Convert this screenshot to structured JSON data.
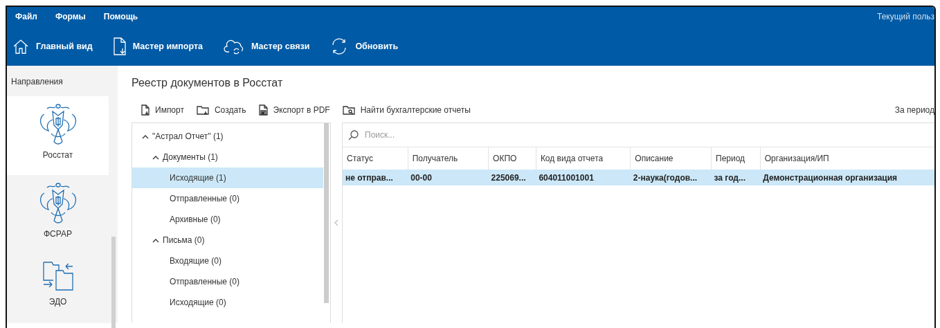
{
  "menu": [
    {
      "label": "Файл"
    },
    {
      "label": "Формы"
    },
    {
      "label": "Помощь"
    }
  ],
  "current_user": "Текущий польз",
  "toolbar": [
    {
      "label": "Главный вид",
      "kind": "home"
    },
    {
      "label": "Мастер импорта",
      "kind": "import"
    },
    {
      "label": "Мастер связи",
      "kind": "cloud"
    },
    {
      "label": "Обновить",
      "kind": "refresh"
    }
  ],
  "sidebar": {
    "title": "Направления",
    "items": [
      {
        "label": "Росстат",
        "kind": "emblem",
        "selected": true
      },
      {
        "label": "ФСРАР",
        "kind": "emblem",
        "selected": false
      },
      {
        "label": "ЭДО",
        "kind": "exchange",
        "selected": false
      }
    ]
  },
  "page_title": "Реестр документов в Росстат",
  "actions": [
    {
      "label": "Импорт",
      "kind": "import"
    },
    {
      "label": "Создать",
      "kind": "create"
    },
    {
      "label": "Экспорт в PDF",
      "kind": "pdf"
    },
    {
      "label": "Найти бухгалтерские отчеты",
      "kind": "find"
    }
  ],
  "period_label": "За период",
  "tree": [
    {
      "label": "\"Астрал Отчет\" (1)",
      "expanded": true,
      "selected": false,
      "children": [
        {
          "label": "Документы (1)",
          "expanded": true,
          "selected": false,
          "children": [
            {
              "label": "Исходящие (1)",
              "selected": true
            },
            {
              "label": "Отправленные (0)",
              "selected": false
            },
            {
              "label": "Архивные (0)",
              "selected": false
            }
          ]
        },
        {
          "label": "Письма (0)",
          "expanded": true,
          "selected": false,
          "children": [
            {
              "label": "Входящие (0)",
              "selected": false
            },
            {
              "label": "Отправленные (0)",
              "selected": false
            },
            {
              "label": "Исходящие (0)",
              "selected": false
            }
          ]
        }
      ]
    }
  ],
  "search": {
    "placeholder": "Поиск..."
  },
  "table": {
    "columns": [
      "Статус",
      "Получатель",
      "ОКПО",
      "Код вида отчета",
      "Описание",
      "Период",
      "Организация/ИП"
    ],
    "rows": [
      {
        "selected": true,
        "cells": [
          "не отправ...",
          "00-00",
          "225069...",
          "604011001001",
          "2-наука(годов...",
          "за год...",
          "Демонстрационная организация"
        ]
      }
    ]
  }
}
